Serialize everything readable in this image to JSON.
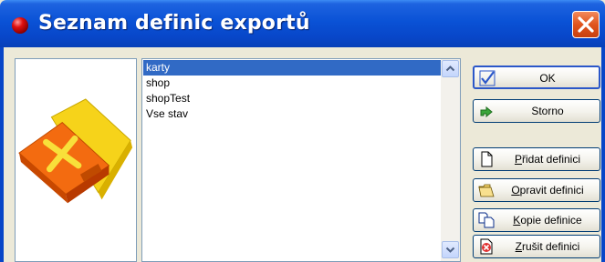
{
  "window": {
    "title": "Seznam definic exportů"
  },
  "list": {
    "items": [
      "karty",
      "shop",
      "shopTest",
      "Vse stav"
    ],
    "selected_index": 0
  },
  "buttons": {
    "ok": "OK",
    "storno": "Storno",
    "pridat_first": "P",
    "pridat_rest": "řidat definici",
    "opravit_first": "O",
    "opravit_rest": "pravit definici",
    "kopie_first": "K",
    "kopie_rest": "opie definice",
    "zrusit_first": "Z",
    "zrusit_rest": "rušit definici"
  },
  "colors": {
    "titlebar": "#0A52D6",
    "selection": "#316AC5",
    "close": "#E0541E",
    "dialog_bg": "#ECE9D8"
  },
  "icons": {
    "app": "red-ball-icon",
    "close": "close-x-icon",
    "export": "export-folder-icon",
    "ok": "checkmark-icon",
    "storno": "undo-arrow-icon",
    "add": "new-document-icon",
    "edit": "open-folder-icon",
    "copy": "copy-documents-icon",
    "delete": "delete-document-icon"
  }
}
